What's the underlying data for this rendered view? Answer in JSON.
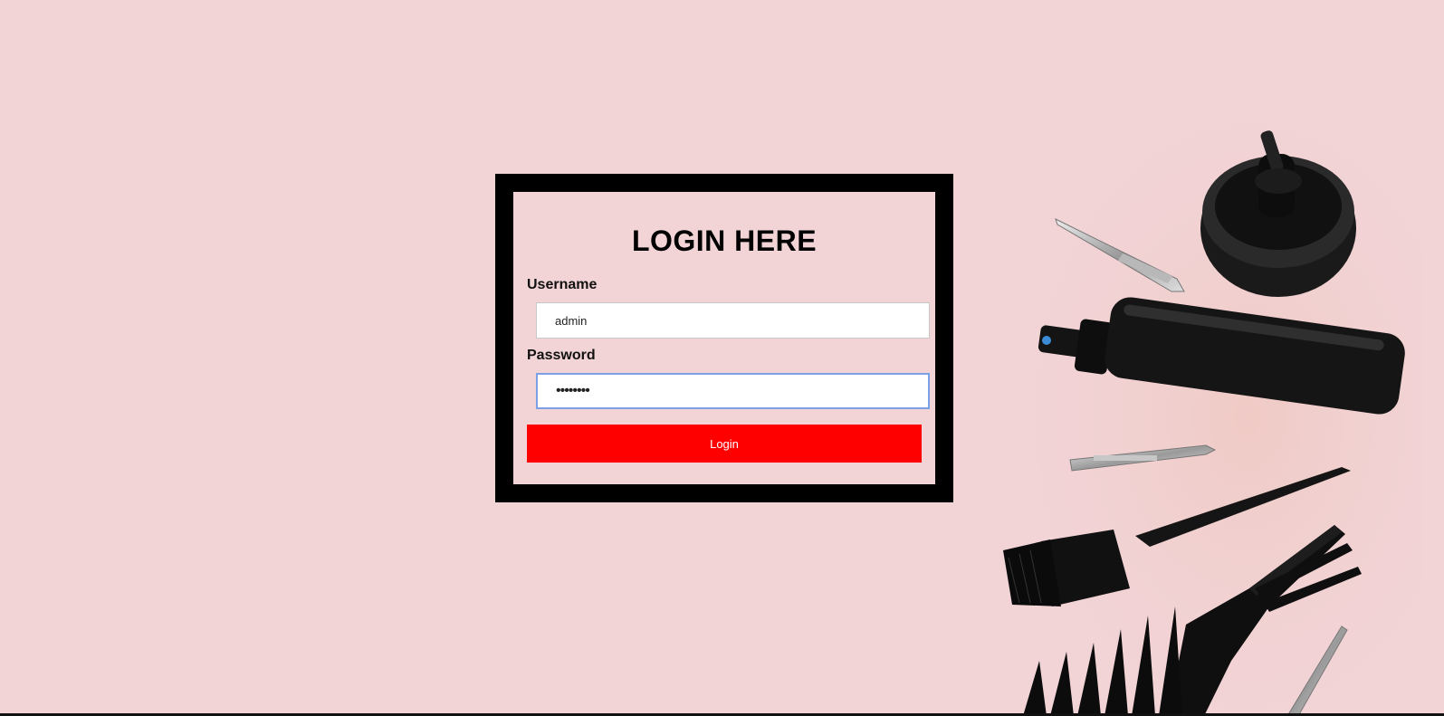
{
  "login": {
    "title": "LOGIN HERE",
    "username_label": "Username",
    "username_value": "admin",
    "password_label": "Password",
    "password_value": "••••••••",
    "button_label": "Login"
  },
  "colors": {
    "page_background": "#f2d4d7",
    "frame": "#000000",
    "button": "#ff0000",
    "button_text": "#ffffff",
    "focus_border": "#7ba0e6"
  },
  "background_decor": {
    "items": [
      "hair-clip-icon",
      "round-jar-icon",
      "spray-bottle-icon",
      "hair-clip-icon",
      "tint-brush-icon",
      "wide-tooth-comb-icon",
      "hair-clip-icon"
    ]
  }
}
